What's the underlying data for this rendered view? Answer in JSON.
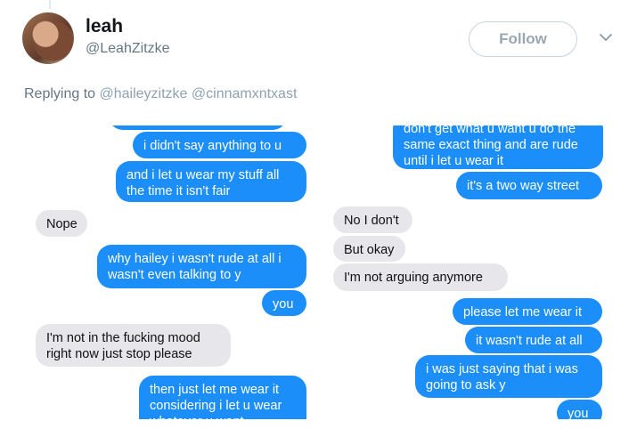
{
  "tweet": {
    "display_name": "leah",
    "handle": "@LeahZitzke",
    "follow_label": "Follow",
    "replying_prefix": "Replying to",
    "replying_mentions": "@haileyzitzke @cinnamxntxast"
  },
  "colors": {
    "imessage_blue": "#1c8ef9",
    "imessage_gray": "#e6e6eb",
    "twitter_secondary": "#657786"
  },
  "left_screenshot": {
    "messages": [
      {
        "sender": "me",
        "text": ""
      },
      {
        "sender": "me",
        "text": "i didn't say anything to u"
      },
      {
        "sender": "me",
        "text": "and i let u wear my stuff all\nthe time it isn't fair"
      },
      {
        "sender": "them",
        "text": "Nope"
      },
      {
        "sender": "me",
        "text": "why hailey i wasn't rude at all i\nwasn't even talking to y"
      },
      {
        "sender": "me",
        "text": "you"
      },
      {
        "sender": "them",
        "text": "I'm not in the fucking mood\nright now just stop please"
      },
      {
        "sender": "me",
        "text": "then just let me wear it\nconsidering i let u wear\nwhatever u want"
      }
    ]
  },
  "right_screenshot": {
    "messages": [
      {
        "sender": "me",
        "text": "don't get what u want u do the\nsame exact thing and are rude\nuntil i let u wear it"
      },
      {
        "sender": "me",
        "text": "it's a two way street"
      },
      {
        "sender": "them",
        "text": "No I don't"
      },
      {
        "sender": "them",
        "text": "But okay"
      },
      {
        "sender": "them",
        "text": "I'm not arguing anymore"
      },
      {
        "sender": "me",
        "text": "please let me wear it"
      },
      {
        "sender": "me",
        "text": "it wasn't rude at all"
      },
      {
        "sender": "me",
        "text": "i was just saying that i was\ngoing to ask y"
      },
      {
        "sender": "me",
        "text": "you"
      }
    ]
  }
}
